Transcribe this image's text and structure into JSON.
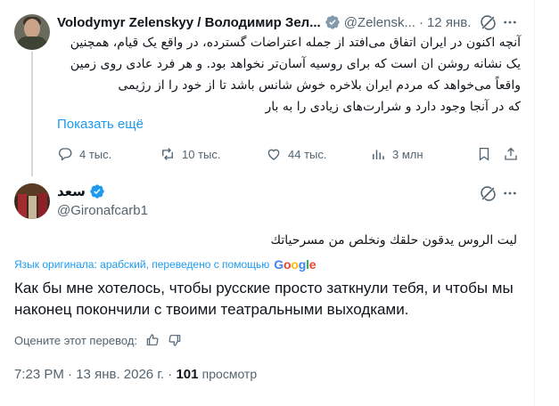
{
  "parent_tweet": {
    "author_name": "Volodymyr Zelenskyy / Володимир Зел...",
    "handle": "@Zelensk...",
    "separator": "·",
    "date": "12 янв.",
    "text_lines": [
      "آنچه اکنون در ایران اتفاق می‌افتد از جمله اعتراضات گسترده، در واقع یک قیام، همچنین",
      "یک نشانه روشن ان است که برای روسیه آسان‌تر نخواهد بود. و هر فرد عادی روی زمین",
      "واقعاً می‌خواهد که مردم ایران بلاخره خوش شانس باشد تا از خود را از رژیمی",
      "که در آنجا وجود دارد و شرارت‌های زیادی را به بار"
    ],
    "show_more_label": "Показать ещё",
    "actions": {
      "replies": "4 тыс.",
      "reposts": "10 тыс.",
      "likes": "44 тыс.",
      "views": "3 млн"
    }
  },
  "main_tweet": {
    "author_name": "سعد",
    "handle": "@Gironafcarb1",
    "original_text": "ليت الروس يدقون حلقك ونخلص من مسرحياتك",
    "translated_by_label": "Язык оригинала: арабский, переведено с помощью",
    "google_logo_letters": [
      "G",
      "o",
      "o",
      "g",
      "l",
      "e"
    ],
    "translated_text": "Как бы мне хотелось, чтобы русские просто заткнули тебя, и чтобы мы наконец покончили с твоими театральными выходками.",
    "rate_label": "Оцените этот перевод:",
    "time": "7:23 PM",
    "date": "13 янв. 2026 г.",
    "separator": "·",
    "views_count": "101",
    "views_label": "просмотр"
  },
  "colors": {
    "accent": "#1d9bf0",
    "text_primary": "#0f1419",
    "text_secondary": "#536471",
    "google": [
      "#4285F4",
      "#EA4335",
      "#FBBC05",
      "#4285F4",
      "#34A853",
      "#EA4335"
    ]
  },
  "icons": {
    "verified": "verified-badge-icon",
    "grok": "grok-icon",
    "more": "more-dots-icon",
    "reply": "reply-icon",
    "repost": "repost-icon",
    "like": "heart-icon",
    "views": "analytics-icon",
    "bookmark": "bookmark-icon",
    "share": "share-icon",
    "thumb_up": "thumb-up-icon",
    "thumb_down": "thumb-down-icon"
  }
}
